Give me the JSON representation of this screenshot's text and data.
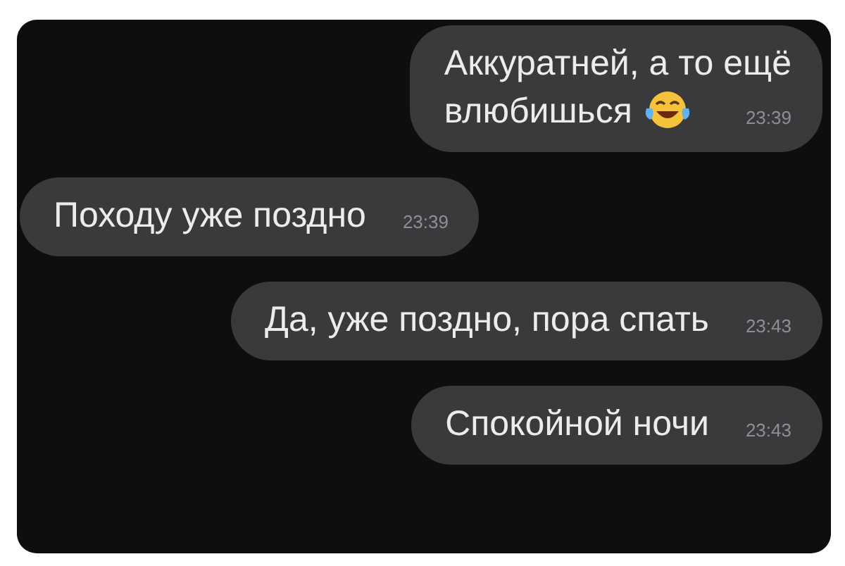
{
  "messages": [
    {
      "kind": "outgoing",
      "lines": [
        "Аккуратней, а то ещё",
        "влюбишься"
      ],
      "emoji": true,
      "time": "23:39"
    },
    {
      "kind": "incoming",
      "lines": [
        "Походу уже поздно"
      ],
      "emoji": false,
      "time": "23:39"
    },
    {
      "kind": "outgoing",
      "lines": [
        "Да, уже поздно, пора спать"
      ],
      "emoji": false,
      "time": "23:43"
    },
    {
      "kind": "outgoing",
      "lines": [
        "Спокойной ночи"
      ],
      "emoji": false,
      "time": "23:43"
    }
  ]
}
